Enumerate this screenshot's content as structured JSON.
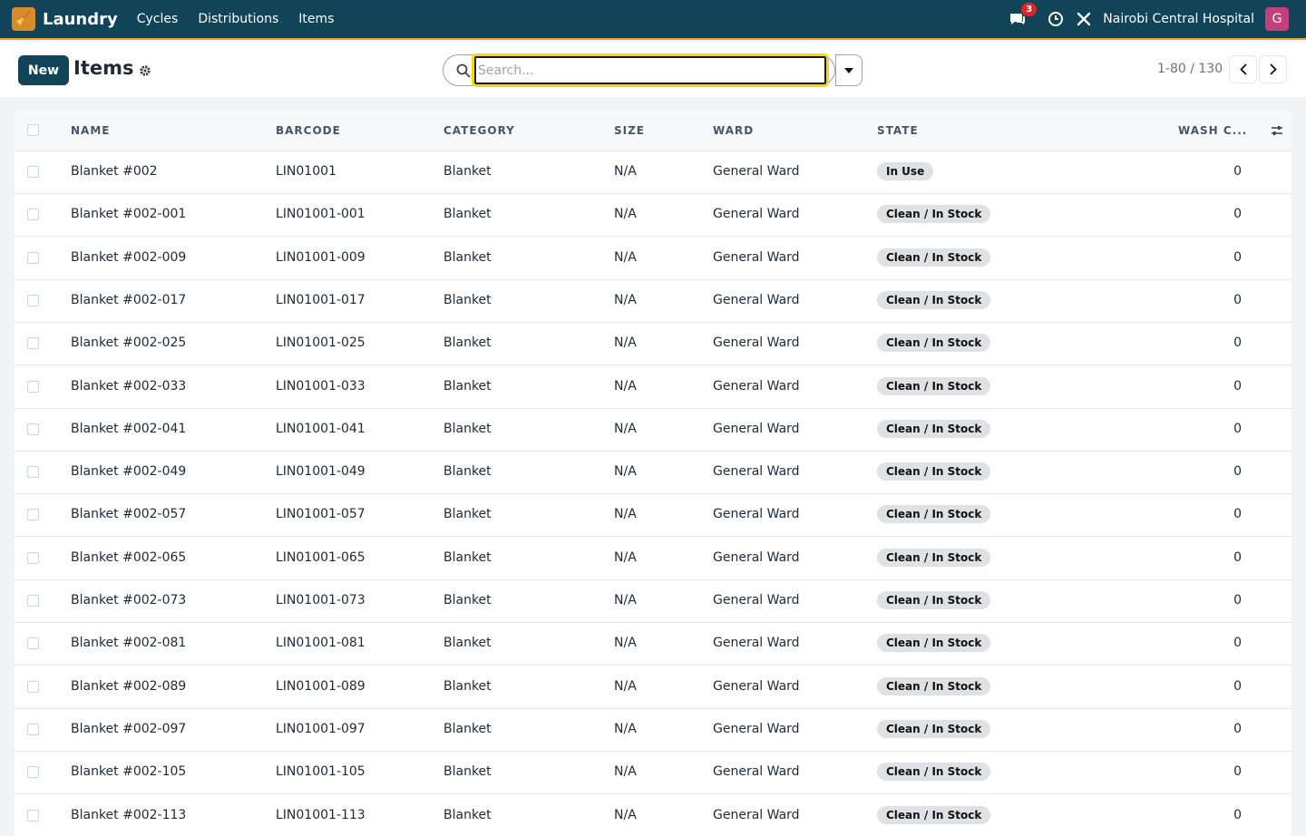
{
  "navbar": {
    "logo_icon": "broom-icon",
    "app_name": "Laundry",
    "links": [
      "Cycles",
      "Distributions",
      "Items"
    ],
    "messages_badge": "3",
    "company": "Nairobi Central Hospital",
    "avatar_letter": "G",
    "colors": {
      "bar": "#124459",
      "accent": "#e8a13a",
      "avatar": "#c2417d",
      "badge": "#dc2626"
    }
  },
  "controls": {
    "new_label": "New",
    "title": "Items",
    "search_placeholder": "Search...",
    "pager": "1-80 / 130"
  },
  "table": {
    "headers": [
      "NAME",
      "BARCODE",
      "CATEGORY",
      "SIZE",
      "WARD",
      "STATE",
      "WASH C..."
    ],
    "rows": [
      {
        "name": "Blanket #002",
        "barcode": "LIN01001",
        "category": "Blanket",
        "size": "N/A",
        "ward": "General Ward",
        "state": "In Use",
        "wash": "0"
      },
      {
        "name": "Blanket #002-001",
        "barcode": "LIN01001-001",
        "category": "Blanket",
        "size": "N/A",
        "ward": "General Ward",
        "state": "Clean / In Stock",
        "wash": "0"
      },
      {
        "name": "Blanket #002-009",
        "barcode": "LIN01001-009",
        "category": "Blanket",
        "size": "N/A",
        "ward": "General Ward",
        "state": "Clean / In Stock",
        "wash": "0"
      },
      {
        "name": "Blanket #002-017",
        "barcode": "LIN01001-017",
        "category": "Blanket",
        "size": "N/A",
        "ward": "General Ward",
        "state": "Clean / In Stock",
        "wash": "0"
      },
      {
        "name": "Blanket #002-025",
        "barcode": "LIN01001-025",
        "category": "Blanket",
        "size": "N/A",
        "ward": "General Ward",
        "state": "Clean / In Stock",
        "wash": "0"
      },
      {
        "name": "Blanket #002-033",
        "barcode": "LIN01001-033",
        "category": "Blanket",
        "size": "N/A",
        "ward": "General Ward",
        "state": "Clean / In Stock",
        "wash": "0"
      },
      {
        "name": "Blanket #002-041",
        "barcode": "LIN01001-041",
        "category": "Blanket",
        "size": "N/A",
        "ward": "General Ward",
        "state": "Clean / In Stock",
        "wash": "0"
      },
      {
        "name": "Blanket #002-049",
        "barcode": "LIN01001-049",
        "category": "Blanket",
        "size": "N/A",
        "ward": "General Ward",
        "state": "Clean / In Stock",
        "wash": "0"
      },
      {
        "name": "Blanket #002-057",
        "barcode": "LIN01001-057",
        "category": "Blanket",
        "size": "N/A",
        "ward": "General Ward",
        "state": "Clean / In Stock",
        "wash": "0"
      },
      {
        "name": "Blanket #002-065",
        "barcode": "LIN01001-065",
        "category": "Blanket",
        "size": "N/A",
        "ward": "General Ward",
        "state": "Clean / In Stock",
        "wash": "0"
      },
      {
        "name": "Blanket #002-073",
        "barcode": "LIN01001-073",
        "category": "Blanket",
        "size": "N/A",
        "ward": "General Ward",
        "state": "Clean / In Stock",
        "wash": "0"
      },
      {
        "name": "Blanket #002-081",
        "barcode": "LIN01001-081",
        "category": "Blanket",
        "size": "N/A",
        "ward": "General Ward",
        "state": "Clean / In Stock",
        "wash": "0"
      },
      {
        "name": "Blanket #002-089",
        "barcode": "LIN01001-089",
        "category": "Blanket",
        "size": "N/A",
        "ward": "General Ward",
        "state": "Clean / In Stock",
        "wash": "0"
      },
      {
        "name": "Blanket #002-097",
        "barcode": "LIN01001-097",
        "category": "Blanket",
        "size": "N/A",
        "ward": "General Ward",
        "state": "Clean / In Stock",
        "wash": "0"
      },
      {
        "name": "Blanket #002-105",
        "barcode": "LIN01001-105",
        "category": "Blanket",
        "size": "N/A",
        "ward": "General Ward",
        "state": "Clean / In Stock",
        "wash": "0"
      },
      {
        "name": "Blanket #002-113",
        "barcode": "LIN01001-113",
        "category": "Blanket",
        "size": "N/A",
        "ward": "General Ward",
        "state": "Clean / In Stock",
        "wash": "0"
      }
    ]
  }
}
